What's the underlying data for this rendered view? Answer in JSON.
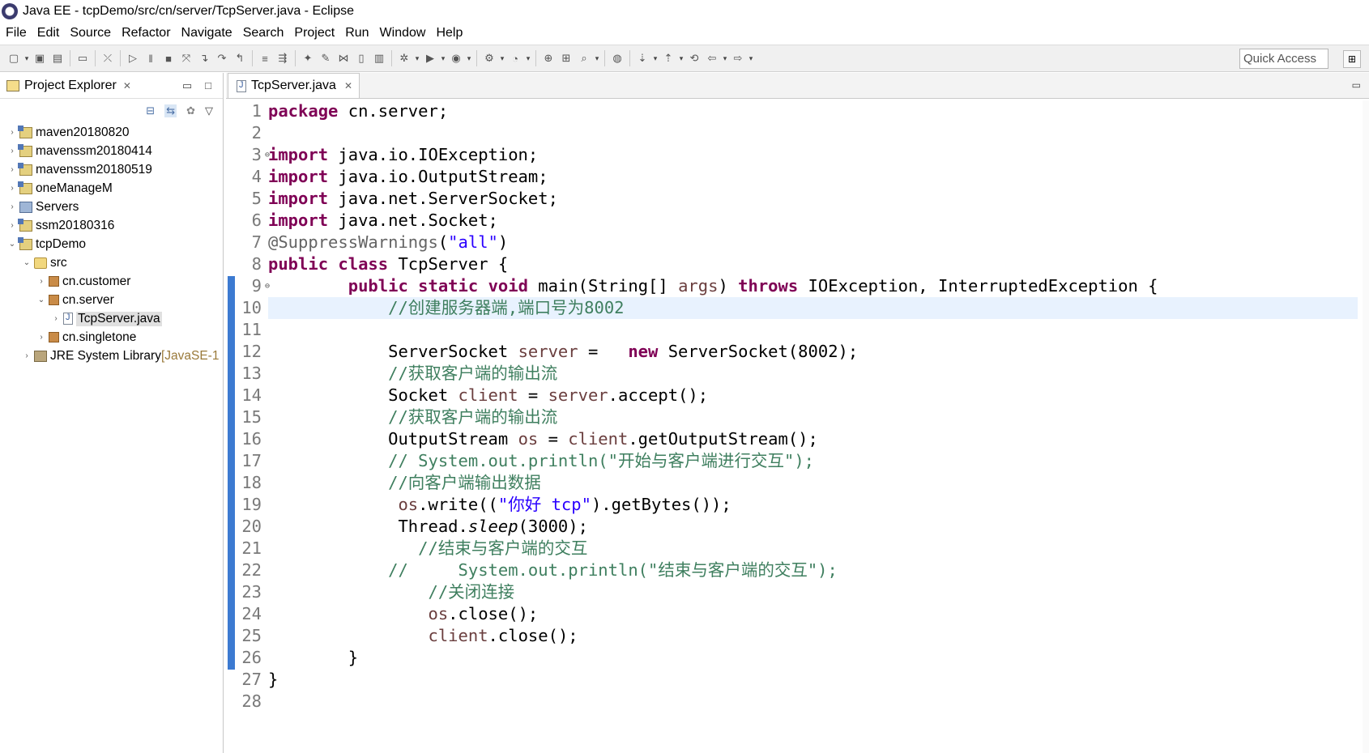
{
  "window": {
    "title": "Java EE - tcpDemo/src/cn/server/TcpServer.java - Eclipse"
  },
  "menu": [
    "File",
    "Edit",
    "Source",
    "Refactor",
    "Navigate",
    "Search",
    "Project",
    "Run",
    "Window",
    "Help"
  ],
  "toolbar": {
    "quick_access_placeholder": "Quick Access"
  },
  "explorer": {
    "tab_label": "Project Explorer",
    "tree": [
      {
        "label": "maven20180820",
        "icon": "project-icon",
        "twisty": "›",
        "depth": 0
      },
      {
        "label": "mavenssm20180414",
        "icon": "project-icon",
        "twisty": "›",
        "depth": 0
      },
      {
        "label": "mavenssm20180519",
        "icon": "project-icon",
        "twisty": "›",
        "depth": 0
      },
      {
        "label": "oneManageM",
        "icon": "project-icon",
        "twisty": "›",
        "depth": 0
      },
      {
        "label": "Servers",
        "icon": "servers-icon",
        "twisty": "›",
        "depth": 0
      },
      {
        "label": "ssm20180316",
        "icon": "project-icon",
        "twisty": "›",
        "depth": 0
      },
      {
        "label": "tcpDemo",
        "icon": "project-icon",
        "twisty": "⌄",
        "depth": 0
      },
      {
        "label": "src",
        "icon": "folder-icon",
        "twisty": "⌄",
        "depth": 1
      },
      {
        "label": "cn.customer",
        "icon": "package-icon",
        "twisty": "›",
        "depth": 2
      },
      {
        "label": "cn.server",
        "icon": "package-icon",
        "twisty": "⌄",
        "depth": 2
      },
      {
        "label": "TcpServer.java",
        "icon": "java-file-icon",
        "twisty": "›",
        "depth": 3,
        "selected": true
      },
      {
        "label": "cn.singletone",
        "icon": "package-icon",
        "twisty": "›",
        "depth": 2
      },
      {
        "label": "JRE System Library",
        "suffix": "[JavaSE-1",
        "icon": "library-icon",
        "twisty": "›",
        "depth": 1
      }
    ]
  },
  "editor": {
    "tab_label": "TcpServer.java",
    "current_line": 10,
    "line_numbers": [
      "1",
      "2",
      "3",
      "4",
      "5",
      "6",
      "7",
      "8",
      "9",
      "10",
      "11",
      "12",
      "13",
      "14",
      "15",
      "16",
      "17",
      "18",
      "19",
      "20",
      "21",
      "22",
      "23",
      "24",
      "25",
      "26",
      "27",
      "28"
    ],
    "folding_lines": [
      3,
      9
    ],
    "lines": [
      [
        [
          "kw",
          "package"
        ],
        [
          "ident",
          " cn.server;"
        ]
      ],
      [],
      [
        [
          "kw",
          "import"
        ],
        [
          "ident",
          " java.io.IOException;"
        ]
      ],
      [
        [
          "kw",
          "import"
        ],
        [
          "ident",
          " java.io.OutputStream;"
        ]
      ],
      [
        [
          "kw",
          "import"
        ],
        [
          "ident",
          " java.net.ServerSocket;"
        ]
      ],
      [
        [
          "kw",
          "import"
        ],
        [
          "ident",
          " java.net.Socket;"
        ]
      ],
      [
        [
          "ann",
          "@SuppressWarnings"
        ],
        [
          "ident",
          "("
        ],
        [
          "str",
          "\"all\""
        ],
        [
          "ident",
          ")"
        ]
      ],
      [
        [
          "kw",
          "public"
        ],
        [
          "ident",
          " "
        ],
        [
          "kw",
          "class"
        ],
        [
          "ident",
          " TcpServer {"
        ]
      ],
      [
        [
          "ident",
          "        "
        ],
        [
          "kw",
          "public"
        ],
        [
          "ident",
          " "
        ],
        [
          "kw",
          "static"
        ],
        [
          "ident",
          " "
        ],
        [
          "kw",
          "void"
        ],
        [
          "ident",
          " main(String[] "
        ],
        [
          "fld",
          "args"
        ],
        [
          "ident",
          ") "
        ],
        [
          "kw",
          "throws"
        ],
        [
          "ident",
          " IOException, InterruptedException {"
        ]
      ],
      [
        [
          "ident",
          "            "
        ],
        [
          "cm",
          "//创建服务器端,端口号为8002"
        ]
      ],
      [],
      [
        [
          "ident",
          "            ServerSocket "
        ],
        [
          "fld",
          "server"
        ],
        [
          "ident",
          " =   "
        ],
        [
          "kw",
          "new"
        ],
        [
          "ident",
          " ServerSocket(8002);"
        ]
      ],
      [
        [
          "ident",
          "            "
        ],
        [
          "cm",
          "//获取客户端的输出流"
        ]
      ],
      [
        [
          "ident",
          "            Socket "
        ],
        [
          "fld",
          "client"
        ],
        [
          "ident",
          " = "
        ],
        [
          "fld",
          "server"
        ],
        [
          "ident",
          ".accept();"
        ]
      ],
      [
        [
          "ident",
          "            "
        ],
        [
          "cm",
          "//获取客户端的输出流"
        ]
      ],
      [
        [
          "ident",
          "            OutputStream "
        ],
        [
          "fld",
          "os"
        ],
        [
          "ident",
          " = "
        ],
        [
          "fld",
          "client"
        ],
        [
          "ident",
          ".getOutputStream();"
        ]
      ],
      [
        [
          "ident",
          "            "
        ],
        [
          "cm",
          "// System.out.println(\"开始与客户端进行交互\");"
        ]
      ],
      [
        [
          "ident",
          "            "
        ],
        [
          "cm",
          "//向客户端输出数据"
        ]
      ],
      [
        [
          "ident",
          "             "
        ],
        [
          "fld",
          "os"
        ],
        [
          "ident",
          ".write(("
        ],
        [
          "str",
          "\"你好 tcp\""
        ],
        [
          "ident",
          ").getBytes());"
        ]
      ],
      [
        [
          "ident",
          "             Thread."
        ],
        [
          "ital",
          "sleep"
        ],
        [
          "ident",
          "(3000);"
        ]
      ],
      [
        [
          "ident",
          "               "
        ],
        [
          "cm",
          "//结束与客户端的交互"
        ]
      ],
      [
        [
          "ident",
          "            "
        ],
        [
          "cm",
          "//     System.out.println(\"结束与客户端的交互\");"
        ]
      ],
      [
        [
          "ident",
          "                "
        ],
        [
          "cm",
          "//关闭连接"
        ]
      ],
      [
        [
          "ident",
          "                "
        ],
        [
          "fld",
          "os"
        ],
        [
          "ident",
          ".close();"
        ]
      ],
      [
        [
          "ident",
          "                "
        ],
        [
          "fld",
          "client"
        ],
        [
          "ident",
          ".close();"
        ]
      ],
      [
        [
          "ident",
          "        }"
        ]
      ],
      [
        [
          "ident",
          "}"
        ]
      ],
      []
    ]
  }
}
